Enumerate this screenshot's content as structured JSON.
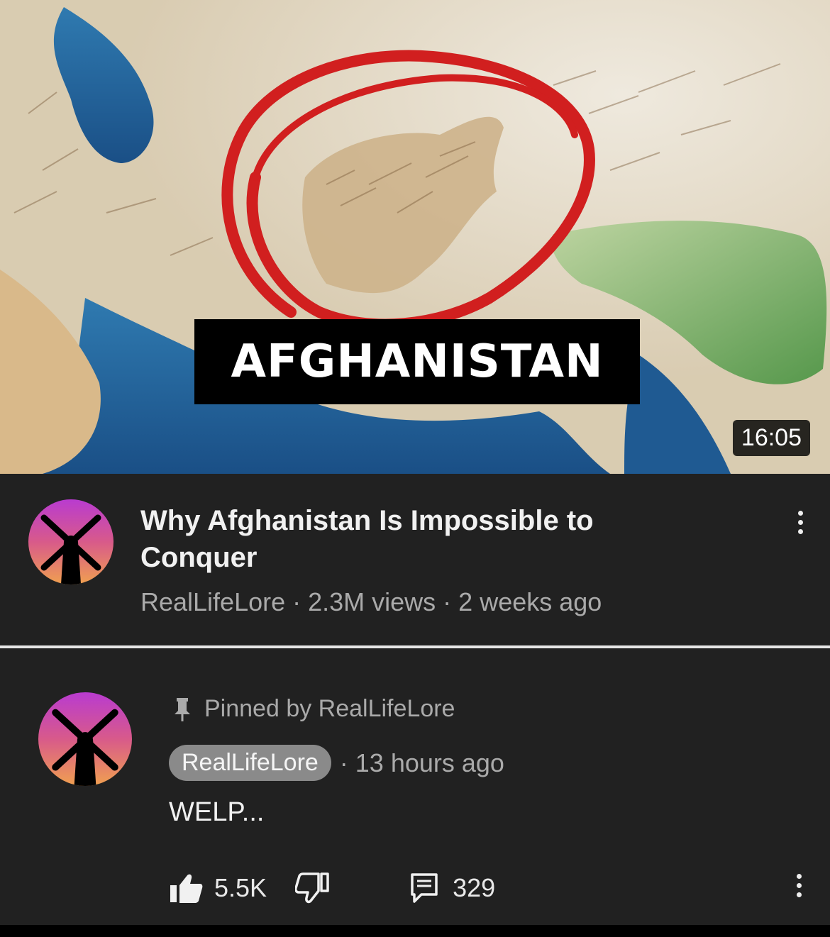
{
  "thumbnail": {
    "label": "AFGHANISTAN",
    "duration": "16:05"
  },
  "video": {
    "title": "Why Afghanistan Is Impossible to Conquer",
    "meta": "RealLifeLore · 2.3M views · 2 weeks ago",
    "channel_avatar_icon": "windmill-icon",
    "menu_icon": "more-vertical-icon"
  },
  "comment": {
    "pinned_text": "Pinned by RealLifeLore",
    "pin_icon": "pin-icon",
    "author": "RealLifeLore",
    "time": "· 13 hours ago",
    "text": "WELP...",
    "likes": "5.5K",
    "replies": "329",
    "like_icon": "thumbs-up-filled-icon",
    "dislike_icon": "thumbs-down-icon",
    "reply_icon": "comment-icon",
    "menu_icon": "more-vertical-icon"
  },
  "colors": {
    "background": "#212121",
    "annotation_circle": "#d11f1f",
    "meta_text": "#aaaaaa"
  }
}
